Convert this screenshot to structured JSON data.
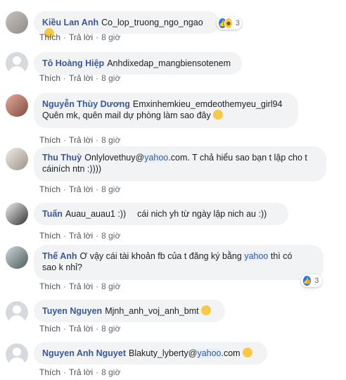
{
  "actions": {
    "like": "Thích",
    "reply": "Trả lời",
    "sep": "·"
  },
  "comments": [
    {
      "name": "Kiều Lan Anh",
      "text": "Co_lop_truong_ngo_ngao",
      "time": "8 giờ",
      "reaction_count": "3",
      "reaction_icons": [
        "like-icon",
        "haha-icon"
      ],
      "emoji": "laughing-emoji"
    },
    {
      "name": "Tô Hoàng Hiệp",
      "text": "Anhdixedap_mangbiensotenem",
      "time": "8 giờ"
    },
    {
      "name": "Nguyễn Thùy Dương",
      "text_line1": "Emxinhemkieu_emdeothemyeu_girl94",
      "text_line2": "Quên mk, quên mail dự phòng làm sao đây",
      "time": "8 giờ",
      "emoji": "sad-emoji"
    },
    {
      "name": "Thu Thuỳ",
      "text_pre": "Onlylovethuy@",
      "link": "yahoo",
      "text_post": ".com. T chả hiểu sao bạn t lập cho t",
      "text_line2": "cáiních ntn :))))",
      "time": "8 giờ"
    },
    {
      "name": "Tuấn",
      "text_pre": "Auau_auau1 :))",
      "text_post": "cái nich yh từ ngày lập nich au :))",
      "time": "8 giờ"
    },
    {
      "name": "Thế Anh",
      "text_pre": "Ơ vậy cái tài khoản fb của t đăng ký bằng",
      "link": "yahoo",
      "text_post": "thì có",
      "text_line2": "sao k nhỉ?",
      "time": "8 giờ",
      "reaction_count": "3",
      "reaction_icons": [
        "like-icon"
      ]
    },
    {
      "name": "Tuyen Nguyen",
      "text": "Mjnh_anh_voj_anh_bmt",
      "time": "8 giờ",
      "emoji": "confused-emoji"
    },
    {
      "name": "Nguyen Anh Nguyet",
      "text_pre": "Blakuty_lyberty@",
      "link": "yahoo",
      "text_post": ".com",
      "time": "8 giờ",
      "emoji": "crying-emoji"
    }
  ]
}
